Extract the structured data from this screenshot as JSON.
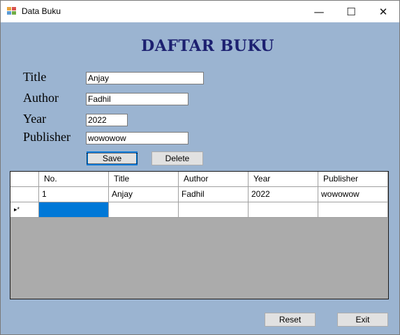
{
  "window": {
    "title": "Data Buku",
    "minimize_glyph": "—",
    "maximize_glyph": "☐",
    "close_glyph": "✕",
    "icon": "app-form-icon"
  },
  "heading": "DAFTAR BUKU",
  "form": {
    "title_label": "Title",
    "title_value": "Anjay",
    "author_label": "Author",
    "author_value": "Fadhil",
    "year_label": "Year",
    "year_value": "2022",
    "publisher_label": "Publisher",
    "publisher_value": "wowowow"
  },
  "buttons": {
    "save": "Save",
    "delete": "Delete",
    "reset": "Reset",
    "exit": "Exit"
  },
  "grid": {
    "columns": [
      "No.",
      "Title",
      "Author",
      "Year",
      "Publisher"
    ],
    "rows": [
      [
        "1",
        "Anjay",
        "Fadhil",
        "2022",
        "wowowow"
      ]
    ],
    "new_row_marker": "▸*",
    "selection_color": "#0078d7"
  }
}
